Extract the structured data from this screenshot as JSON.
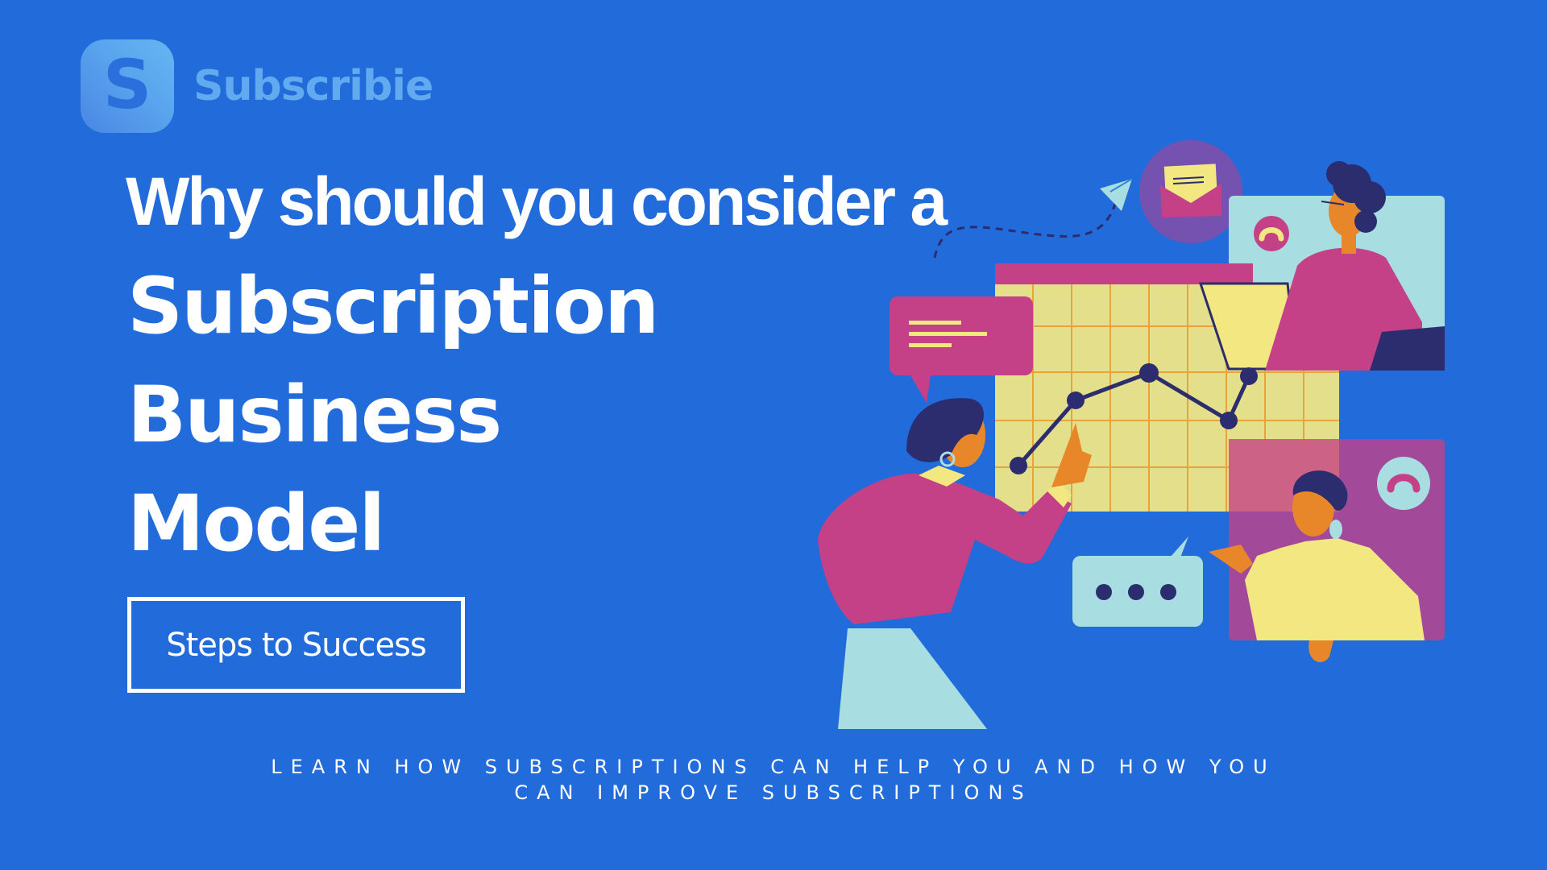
{
  "brand": {
    "logo_letter": "S",
    "name": "Subscribie"
  },
  "headline": {
    "line1": "Why should you consider a",
    "line2": "Subscription",
    "line3": "Business",
    "line4": "Model"
  },
  "cta": {
    "label": "Steps to Success"
  },
  "footer": {
    "line1": "LEARN HOW SUBSCRIPTIONS CAN HELP YOU AND HOW YOU",
    "line2": "CAN IMPROVE SUBSCRIPTIONS"
  },
  "illustration": {
    "description": "People collaborating around a growth line chart with chat bubbles, email and video-call windows",
    "icons": [
      "paper-plane-icon",
      "envelope-icon",
      "chat-bubble-text-icon",
      "chat-bubble-typing-icon",
      "end-call-icon"
    ]
  },
  "colors": {
    "background": "#226bdb",
    "logo_text": "#62aaf0",
    "magenta": "#c44187",
    "yellow": "#e4df8a",
    "navy": "#2b2d6e",
    "orange": "#e8872a",
    "light_blue": "#a8dde2",
    "purple": "#7652b0"
  }
}
